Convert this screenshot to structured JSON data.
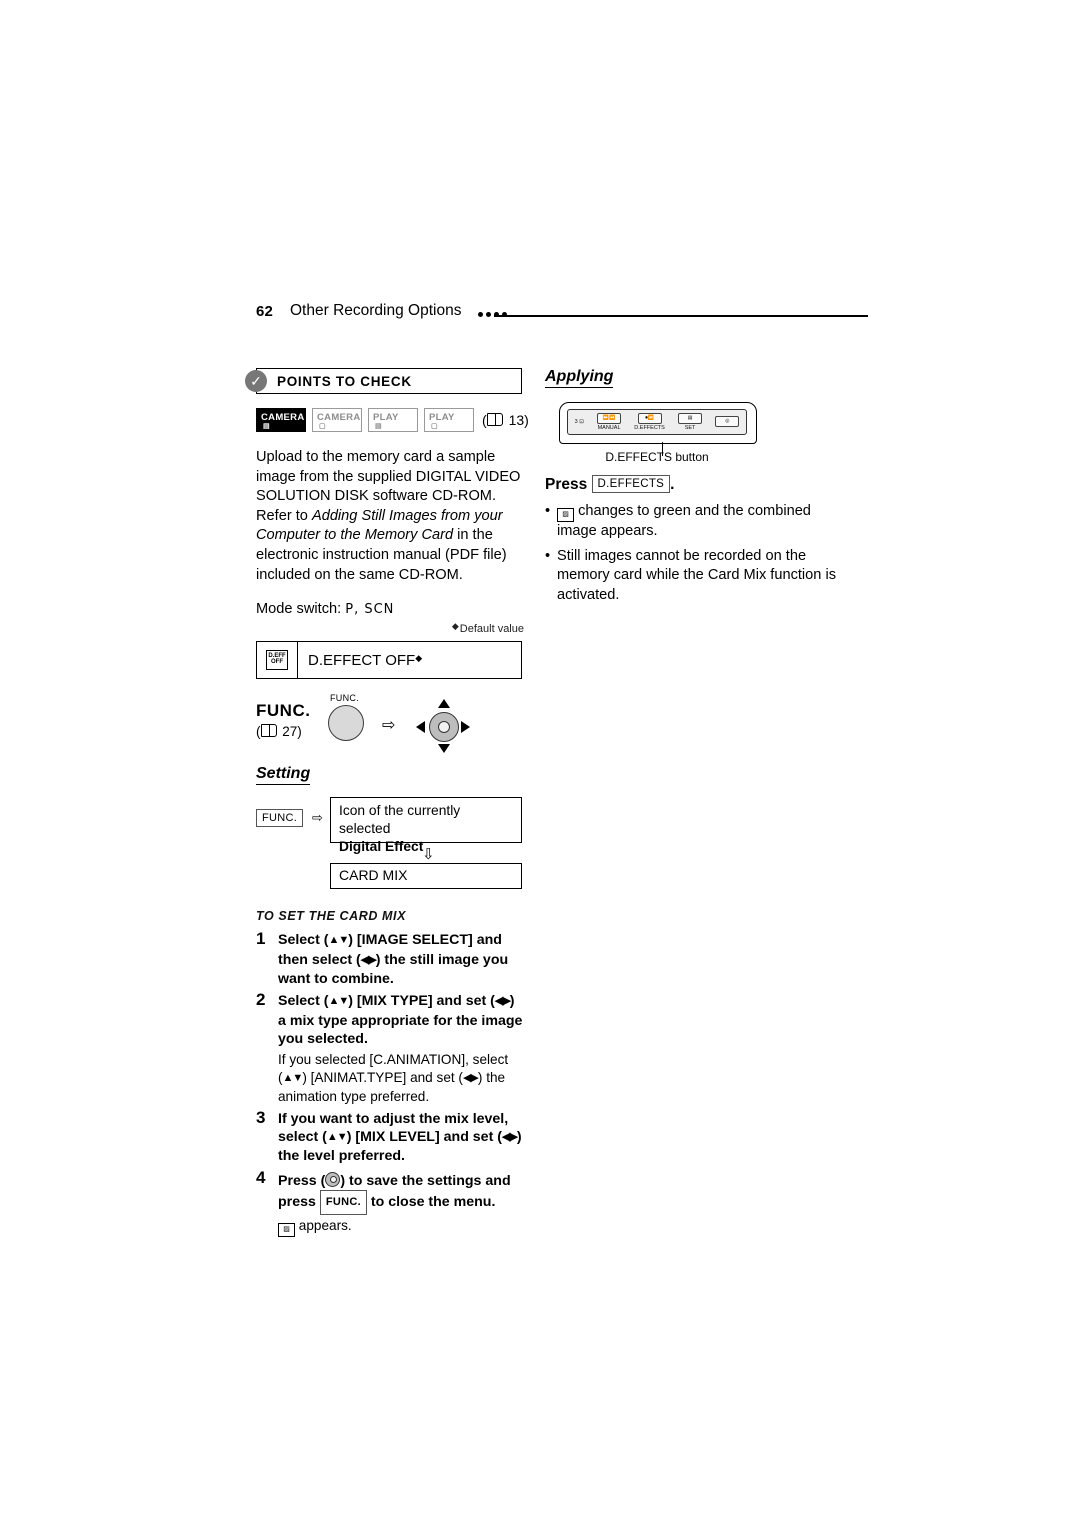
{
  "header": {
    "page_number": "62",
    "chapter": "Other Recording Options"
  },
  "left": {
    "points_to_check": {
      "title": "POINTS TO CHECK",
      "check_icon": "check-icon",
      "modes": [
        {
          "name": "CAMERA",
          "sub": "tape",
          "state": "on"
        },
        {
          "name": "CAMERA",
          "sub": "card",
          "state": "off"
        },
        {
          "name": "PLAY",
          "sub": "tape",
          "state": "off"
        },
        {
          "name": "PLAY",
          "sub": "card",
          "state": "off"
        }
      ],
      "page_ref": "13"
    },
    "body": "Upload to the memory card a sample image from the supplied DIGITAL VIDEO SOLUTION DISK software CD-ROM. Refer to ",
    "body_italic": "Adding Still Images from your Computer to the Memory Card",
    "body_tail": " in the electronic instruction manual (PDF file) included on the same CD-ROM.",
    "mode_switch_label": "Mode switch:",
    "mode_switch_value": "P, SCN",
    "default_value_note": "Default value",
    "option_box": {
      "icon": "d-effect-off-icon",
      "icon_top": "D.EFF",
      "icon_bottom": "OFF",
      "label": "D.EFFECT OFF"
    },
    "func": {
      "label": "FUNC.",
      "page_ref": "27",
      "button_label": "FUNC.",
      "arrow": "⇨"
    },
    "setting": {
      "heading": "Setting",
      "chip": "FUNC.",
      "arrow": "⇨",
      "box_line1": "Icon of the currently selected",
      "box_line2": "Digital Effect",
      "down_arrow": "⇩",
      "box2": "CARD MIX"
    },
    "procedure": {
      "heading": "TO SET THE CARD MIX",
      "steps": [
        {
          "num": "1",
          "text_parts": [
            "Select (",
            "▲▼",
            ") [IMAGE SELECT] and then select (",
            "◀▶",
            ") the still image you want to combine."
          ]
        },
        {
          "num": "2",
          "text_parts": [
            "Select (",
            "▲▼",
            ") [MIX TYPE] and set (",
            "◀▶",
            ") a mix type appropriate for the image you selected."
          ],
          "sub_parts": [
            "If you selected [C.ANIMATION], select (",
            "▲▼",
            ") [ANIMAT.TYPE] and set (",
            "◀▶",
            ") the animation type preferred."
          ]
        },
        {
          "num": "3",
          "text_parts": [
            "If you want to adjust the mix level, select (",
            "▲▼",
            ") [MIX LEVEL] and set (",
            "◀▶",
            ") the level preferred."
          ]
        },
        {
          "num": "4",
          "text_parts": [
            "Press (",
            "joystick",
            ") to save the settings and press ",
            "FUNC.",
            " to close the menu."
          ],
          "sub_parts": [
            "appears."
          ]
        }
      ]
    }
  },
  "right": {
    "heading": "Applying",
    "camera_keys": [
      {
        "top": "3 ⊡",
        "box": ""
      },
      {
        "top": "MANUAL",
        "box": "⏩⏪"
      },
      {
        "top": "D.EFFECTS",
        "box": "⏺⏪"
      },
      {
        "top": "SET",
        "box": "▤"
      },
      {
        "top": "",
        "box": "◎"
      }
    ],
    "diagram_caption": "D.EFFECTS button",
    "press_label": "Press",
    "press_chip": "D.EFFECTS",
    "press_period": ".",
    "bullets": [
      "changes to green and the combined image appears.",
      "Still images cannot be recorded on the memory card while the Card Mix function is activated."
    ]
  }
}
